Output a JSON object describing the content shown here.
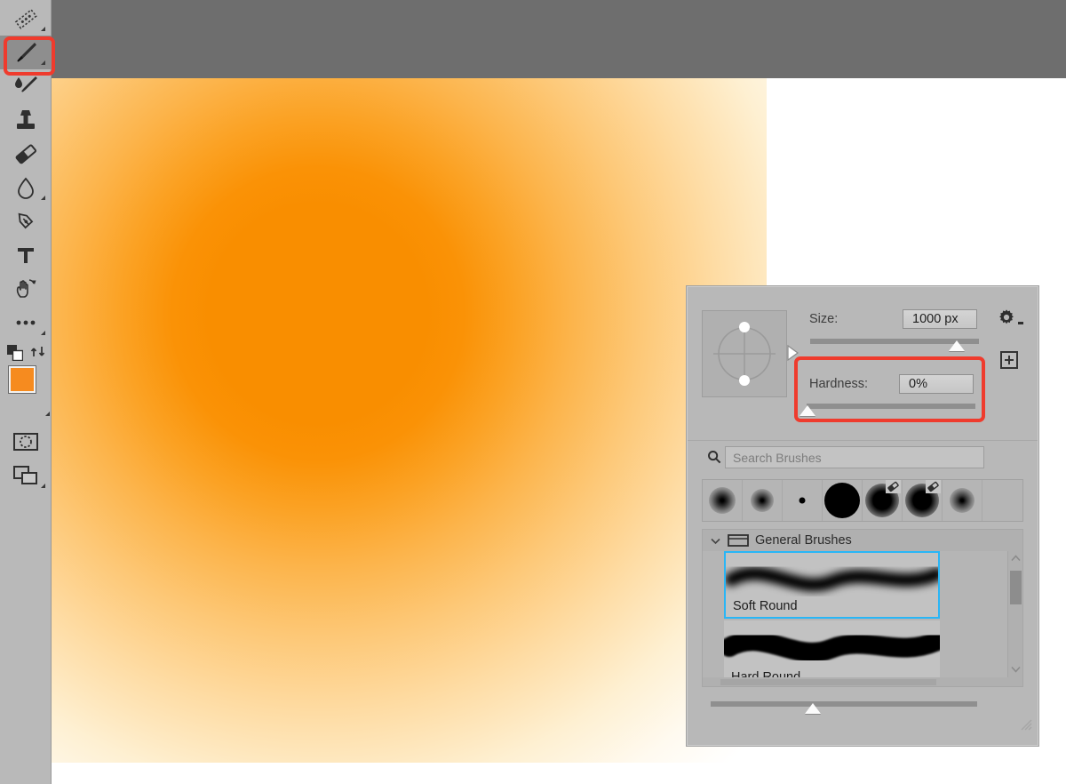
{
  "app": {
    "header_bg": "#6e6e6e",
    "canvas_bg": "#ffffff",
    "accent_highlight": "#ef3b2d",
    "selection_color": "#29b6f6",
    "foreground_color": "#f68b1f",
    "background_color": "#ffffff",
    "panel_bg": "#b8b8b8"
  },
  "canvas": {
    "artwork_name": "orange-soft-round-blob",
    "blob_core_color": "#f98e00",
    "blob_edge_color": "#ffffff"
  },
  "toolbar": {
    "items": [
      {
        "name": "measure-tool",
        "icon": "ruler-icon",
        "has_flyout": true,
        "active": false
      },
      {
        "name": "brush-tool",
        "icon": "paintbrush-icon",
        "has_flyout": true,
        "active": true
      },
      {
        "name": "mixer-brush-tool",
        "icon": "mixer-brush-icon",
        "has_flyout": false,
        "active": false
      },
      {
        "name": "clone-stamp-tool",
        "icon": "clone-stamp-icon",
        "has_flyout": false,
        "active": false
      },
      {
        "name": "eraser-tool",
        "icon": "eraser-icon",
        "has_flyout": false,
        "active": false
      },
      {
        "name": "blur-tool",
        "icon": "waterdrop-icon",
        "has_flyout": true,
        "active": false
      },
      {
        "name": "pen-tool",
        "icon": "pen-nib-icon",
        "has_flyout": false,
        "active": false
      },
      {
        "name": "type-tool",
        "icon": "text-t-icon",
        "has_flyout": false,
        "active": false
      },
      {
        "name": "hand-tool",
        "icon": "hand-rotate-icon",
        "has_flyout": false,
        "active": false
      },
      {
        "name": "edit-toolbar-tool",
        "icon": "ellipsis-icon",
        "has_flyout": true,
        "active": false
      }
    ],
    "default_colors_name": "default-colors-icon",
    "swap_colors_name": "swap-colors-icon",
    "quick_mask_name": "quick-mask-icon",
    "screen_mode_name": "screen-mode-icon"
  },
  "brush_panel": {
    "size": {
      "label": "Size:",
      "value": "1000 px",
      "slider_percent": 96
    },
    "hardness": {
      "label": "Hardness:",
      "value": "0%",
      "slider_percent": 0,
      "highlighted": true
    },
    "gear_icon": "gear-icon",
    "add_preset_icon": "plus-icon",
    "tip_preview_name": "brush-tip-angle-roundness",
    "search": {
      "placeholder": "Search Brushes",
      "value": "",
      "icon": "search-icon"
    },
    "presets": [
      {
        "name": "soft-round-preset-1",
        "hardness": 0,
        "size": 22,
        "badge": ""
      },
      {
        "name": "soft-round-preset-2",
        "hardness": 0,
        "size": 18,
        "badge": ""
      },
      {
        "name": "hard-round-preset-small",
        "hardness": 100,
        "size": 6,
        "badge": ""
      },
      {
        "name": "hard-round-preset-large",
        "hardness": 100,
        "size": 36,
        "badge": ""
      },
      {
        "name": "soft-round-eraser-preset-1",
        "hardness": 35,
        "size": 32,
        "badge": "eraser-badge-icon"
      },
      {
        "name": "soft-round-eraser-preset-2",
        "hardness": 35,
        "size": 32,
        "badge": "eraser-badge-icon"
      },
      {
        "name": "soft-round-preset-3",
        "hardness": 0,
        "size": 20,
        "badge": ""
      }
    ],
    "folder": {
      "label": "General Brushes",
      "expanded": true,
      "icon": "folder-icon",
      "chevron": "chevron-down-icon"
    },
    "brushes": [
      {
        "name": "brush-soft-round",
        "label": "Soft Round",
        "selected": true,
        "hardness": 0
      },
      {
        "name": "brush-hard-round",
        "label": "Hard Round",
        "selected": false,
        "hardness": 100
      }
    ],
    "scroll": {
      "up_icon": "chevron-up-icon",
      "down_icon": "chevron-down-icon",
      "vertical_thumb_percent": 14
    },
    "bottom_slider": {
      "name": "panel-zoom-slider",
      "percent": 38
    },
    "resize_grip": "resize-grip-icon"
  }
}
